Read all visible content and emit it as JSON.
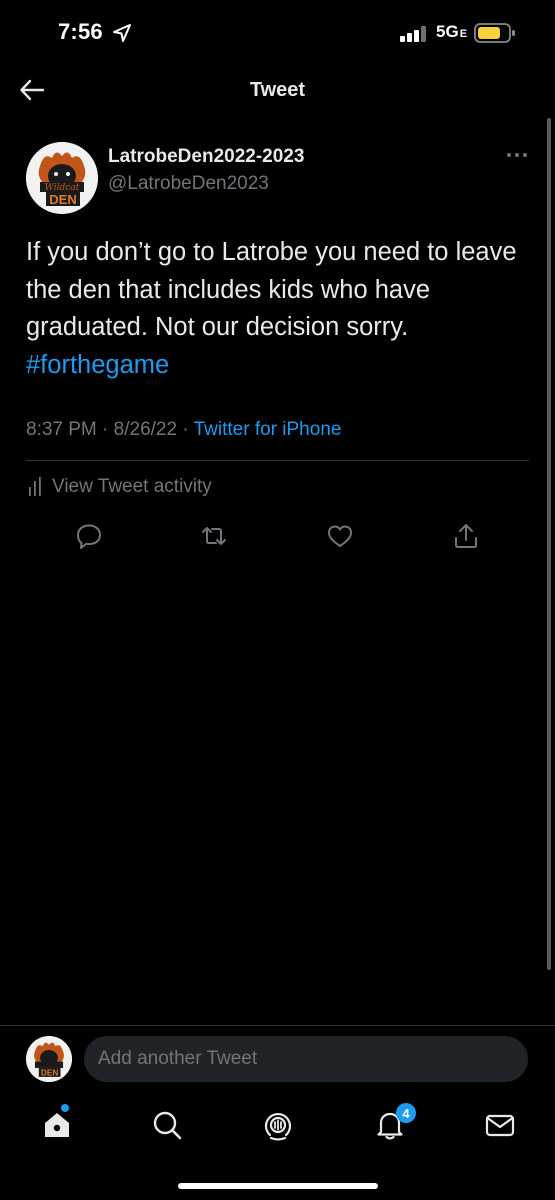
{
  "status_bar": {
    "time": "7:56",
    "network": "5G",
    "network_suffix": "E"
  },
  "header": {
    "title": "Tweet"
  },
  "tweet": {
    "author_name": "LatrobeDen2022-2023",
    "author_handle": "@LatrobeDen2023",
    "text": "If you don’t go to Latrobe you need to leave the den that includes kids who have graduated. Not our decision sorry.",
    "hashtag": "#forthegame",
    "time": "8:37 PM",
    "date": "8/26/22",
    "source": "Twitter for iPhone",
    "activity_label": "View Tweet activity"
  },
  "avatar": {
    "logo_text": "DEN",
    "logo_script": "Wildcat"
  },
  "compose": {
    "placeholder": "Add another Tweet"
  },
  "tabbar": {
    "notifications_count": "4"
  },
  "colors": {
    "background": "#000000",
    "text": "#e7e9ea",
    "muted": "#71767b",
    "accent": "#1d9bf0",
    "divider": "#2f3336",
    "battery": "#f5d23b"
  }
}
